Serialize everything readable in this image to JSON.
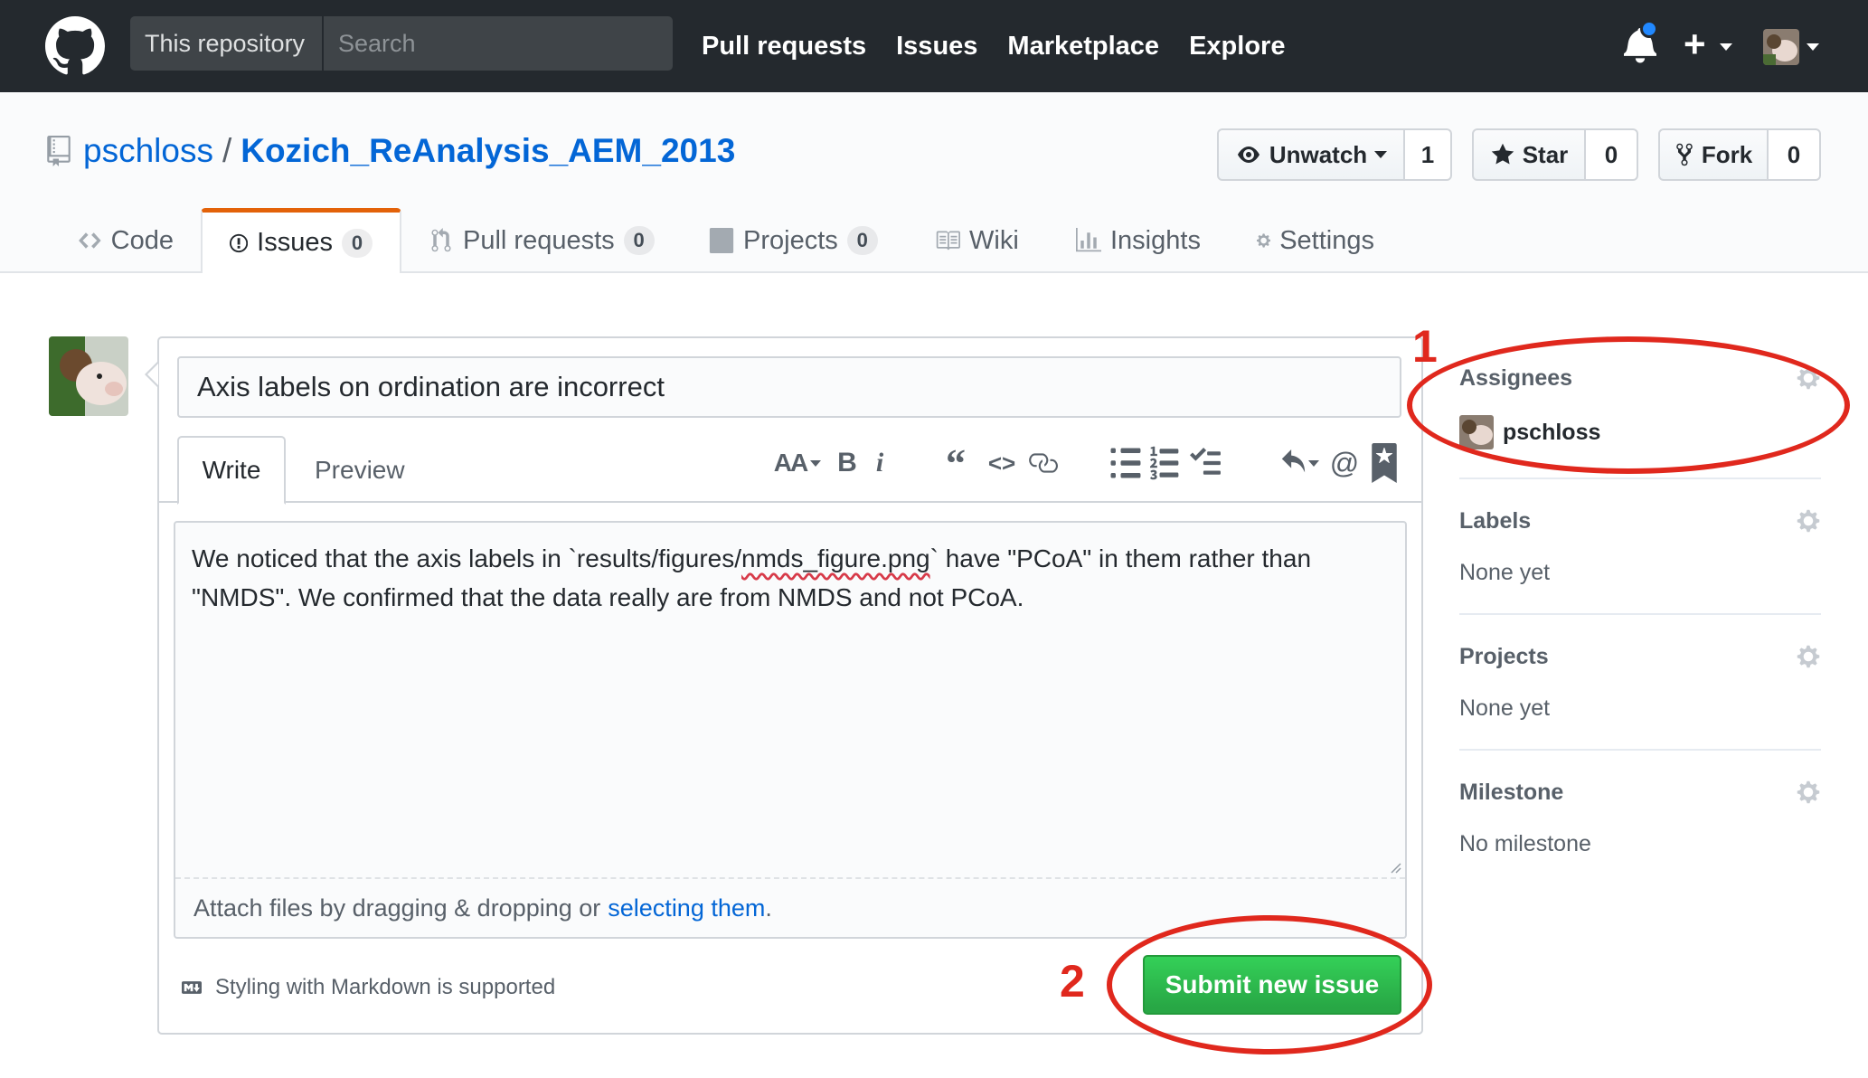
{
  "header": {
    "search_scope": "This repository",
    "search_placeholder": "Search",
    "nav": [
      "Pull requests",
      "Issues",
      "Marketplace",
      "Explore"
    ],
    "plus_label": "+",
    "icons": [
      "github-logo",
      "bell-icon",
      "plus-icon",
      "avatar"
    ]
  },
  "repo": {
    "owner": "pschloss",
    "separator": "/",
    "name": "Kozich_ReAnalysis_AEM_2013",
    "unwatch_label": "Unwatch",
    "watch_count": "1",
    "star_label": "Star",
    "star_count": "0",
    "fork_label": "Fork",
    "fork_count": "0"
  },
  "tabs": [
    {
      "label": "Code",
      "count": null
    },
    {
      "label": "Issues",
      "count": "0"
    },
    {
      "label": "Pull requests",
      "count": "0"
    },
    {
      "label": "Projects",
      "count": "0"
    },
    {
      "label": "Wiki",
      "count": null
    },
    {
      "label": "Insights",
      "count": null
    },
    {
      "label": "Settings",
      "count": null
    }
  ],
  "issue_form": {
    "title_value": "Axis labels on ordination are incorrect",
    "write_tab": "Write",
    "preview_tab": "Preview",
    "toolbar": {
      "heading": "AA",
      "bold": "B",
      "italic": "i",
      "quote": "“",
      "code": "<>",
      "at": "@"
    },
    "body_part1": "We noticed that the axis labels in `results/figures/",
    "body_misspelled": "nmds_figure.png",
    "body_part2": "` have \"PCoA\" in them rather than \"NMDS\". We confirmed that the data really are from NMDS and not PCoA.",
    "attach_text": "Attach files by dragging & dropping or",
    "attach_link": "selecting them",
    "attach_end": ".",
    "markdown_note": "Styling with Markdown is supported",
    "submit_label": "Submit new issue"
  },
  "sidebar": {
    "assignees": {
      "title": "Assignees",
      "value": "pschloss"
    },
    "labels": {
      "title": "Labels",
      "value": "None yet"
    },
    "projects": {
      "title": "Projects",
      "value": "None yet"
    },
    "milestone": {
      "title": "Milestone",
      "value": "No milestone"
    }
  },
  "annotations": {
    "first": "1",
    "second": "2"
  },
  "colors": {
    "header_bg": "#24292e",
    "link": "#0366d6",
    "submit": "#28a745",
    "annotation": "#e0281d",
    "selected_tab_border": "#e36209"
  }
}
